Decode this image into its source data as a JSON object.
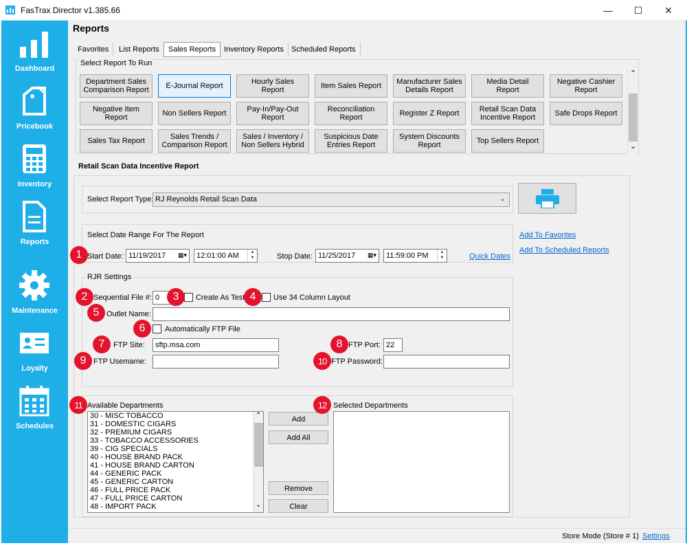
{
  "window": {
    "title": "FasTrax Director v1.385.66",
    "minimize": "—",
    "maximize": "☐",
    "close": "✕"
  },
  "sidebar": {
    "items": [
      {
        "label": "Dashboard",
        "icon": "bar-chart-icon"
      },
      {
        "label": "Pricebook",
        "icon": "price-tag-icon"
      },
      {
        "label": "Inventory",
        "icon": "calculator-icon"
      },
      {
        "label": "Reports",
        "icon": "document-icon"
      },
      {
        "label": "Maintenance",
        "icon": "gear-icon"
      },
      {
        "label": "Loyalty",
        "icon": "id-card-icon"
      },
      {
        "label": "Schedules",
        "icon": "calendar-icon"
      }
    ]
  },
  "header": {
    "title": "Reports"
  },
  "tabs": [
    "Favorites",
    "List Reports",
    "Sales Reports",
    "Inventory Reports",
    "Scheduled Reports"
  ],
  "active_tab": "Sales Reports",
  "report_picker": {
    "label": "Select Report To Run",
    "buttons": [
      "Department Sales Comparison Report",
      "E-Journal Report",
      "Hourly Sales Report",
      "Item Sales Report",
      "Manufacturer Sales Details Report",
      "Media Detail Report",
      "Negative Cashier Report",
      "Negative Item Report",
      "Non Sellers Report",
      "Pay-In/Pay-Out Report",
      "Reconciliation Report",
      "Register Z Report",
      "Retail Scan Data Incentive Report",
      "Safe Drops Report",
      "Sales Tax Report",
      "Sales Trends / Comparison Report",
      "Sales / Inventory / Non Sellers Hybrid",
      "Suspicious Date Entries Report",
      "System Discounts Report",
      "Top Sellers Report"
    ],
    "selected": "E-Journal Report",
    "scroll_up": "⌃",
    "scroll_down": "⌄"
  },
  "section_title": "Retail Scan Data Incentive Report",
  "report_type": {
    "label": "Select Report Type:",
    "value": "RJ Reynolds Retail Scan Data"
  },
  "date_range": {
    "label": "Select Date Range For The Report",
    "start_label": "Start Date:",
    "start_date": "11/19/2017",
    "start_time": "12:01:00 AM",
    "stop_label": "Stop Date:",
    "stop_date": "11/25/2017",
    "stop_time": "11:59:00 PM",
    "quick_dates": "Quick Dates"
  },
  "links": {
    "add_favorites": "Add To Favorites",
    "add_scheduled": "Add To Scheduled Reports"
  },
  "rjr": {
    "label": "RJR Settings",
    "sequential_label": "Sequential File #:",
    "sequential_value": "0",
    "create_test": "Create As Test",
    "use34": "Use 34 Column Layout",
    "outlet_label": "Outlet Name:",
    "outlet_value": "",
    "auto_ftp": "Automatically FTP File",
    "ftp_site_label": "FTP Site:",
    "ftp_site_value": "sftp.msa.com",
    "ftp_port_label": "FTP Port:",
    "ftp_port_value": "22",
    "ftp_user_label": "FTP Usemame:",
    "ftp_user_value": "",
    "ftp_pass_label": "FTP Password:",
    "ftp_pass_value": ""
  },
  "departments": {
    "available_label": "Available Departments",
    "selected_label": "Selected Departments",
    "available": [
      "30 - MISC TOBACCO",
      "31 - DOMESTIC CIGARS",
      "32 - PREMIUM CIGARS",
      "33 - TOBACCO ACCESSORIES",
      "39 - CIG SPECIALS",
      "40 - HOUSE BRAND PACK",
      "41 - HOUSE BRAND CARTON",
      "44 - GENERIC PACK",
      "45 - GENERIC CARTON",
      "46 - FULL PRICE PACK",
      "47 - FULL PRICE CARTON",
      "48 - IMPORT PACK"
    ],
    "add": "Add",
    "add_all": "Add All",
    "remove": "Remove",
    "clear": "Clear"
  },
  "callouts": [
    "1",
    "2",
    "3",
    "4",
    "5",
    "6",
    "7",
    "8",
    "9",
    "10",
    "11",
    "12"
  ],
  "status": {
    "store_mode": "Store Mode (Store # 1)",
    "settings": "Settings"
  },
  "colors": {
    "sidebar": "#1eaee8",
    "callout": "#e3132c",
    "link": "#0066cc",
    "selected_border": "#0078d7"
  }
}
